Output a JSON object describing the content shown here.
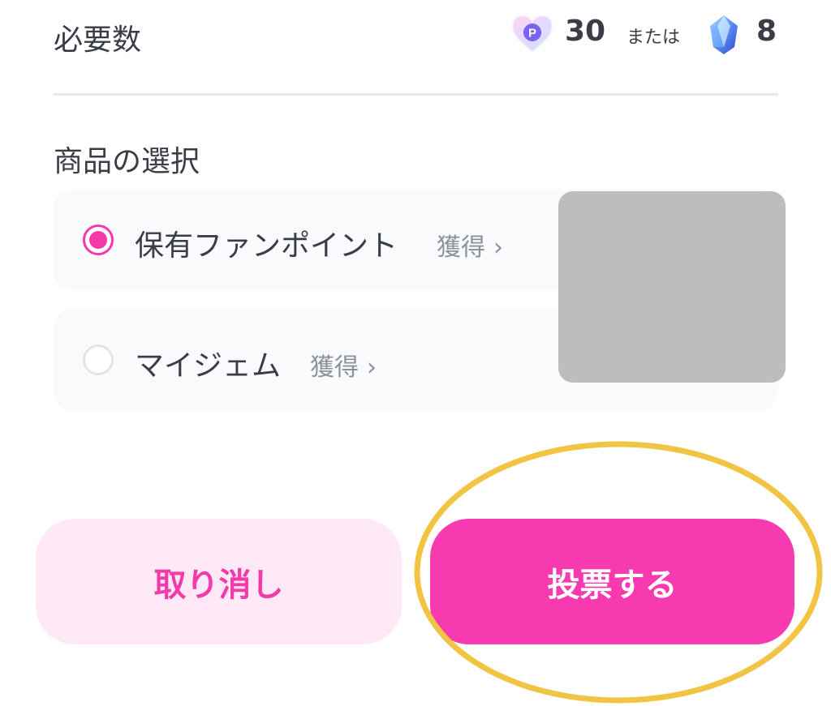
{
  "required": {
    "label": "必要数",
    "points_value": "30",
    "or_text": "または",
    "gems_value": "8",
    "point_icon_letter": "P",
    "point_icon_name": "heart-point-icon",
    "gem_icon_name": "gem-crystal-icon"
  },
  "product_selection": {
    "title": "商品の選択",
    "options": [
      {
        "label": "保有ファンポイント",
        "earn_label": "獲得",
        "selected": true
      },
      {
        "label": "マイジェム",
        "earn_label": "獲得",
        "selected": false
      }
    ]
  },
  "buttons": {
    "cancel_label": "取り消し",
    "vote_label": "投票する"
  },
  "colors": {
    "accent_pink": "#f83ab0",
    "cancel_bg": "#ffe9f6",
    "highlight_ring": "#f2c443",
    "text_dark": "#3a3d47",
    "text_muted": "#8d919b"
  }
}
